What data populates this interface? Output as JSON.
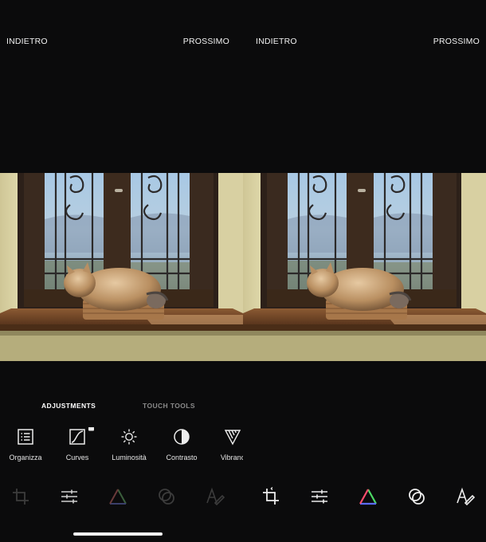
{
  "left_panel": {
    "back_label": "INDIETRO",
    "next_label": "PROSSIMO",
    "mode_tabs": [
      "ADJUSTMENTS",
      "TOUCH TOOLS"
    ],
    "tools": [
      {
        "label": "Organizza",
        "icon": "list-icon"
      },
      {
        "label": "Curves",
        "icon": "curves-icon",
        "locked": true
      },
      {
        "label": "Luminosità",
        "icon": "sun-icon"
      },
      {
        "label": "Contrasto",
        "icon": "contrast-icon"
      },
      {
        "label": "Vibranc",
        "icon": "vibrance-icon"
      }
    ]
  },
  "right_panel": {
    "back_label": "INDIETRO",
    "next_label": "PROSSIMO"
  },
  "bottom_toolbar": [
    "crop-icon",
    "adjust-sliders-icon",
    "color-triangle-icon",
    "filters-icon",
    "text-pen-icon"
  ],
  "colors": {
    "background": "#0b0b0c",
    "active_text": "#ffffff",
    "inactive_text": "#8a8a8a",
    "dim_icon": "#3c3c3c"
  }
}
